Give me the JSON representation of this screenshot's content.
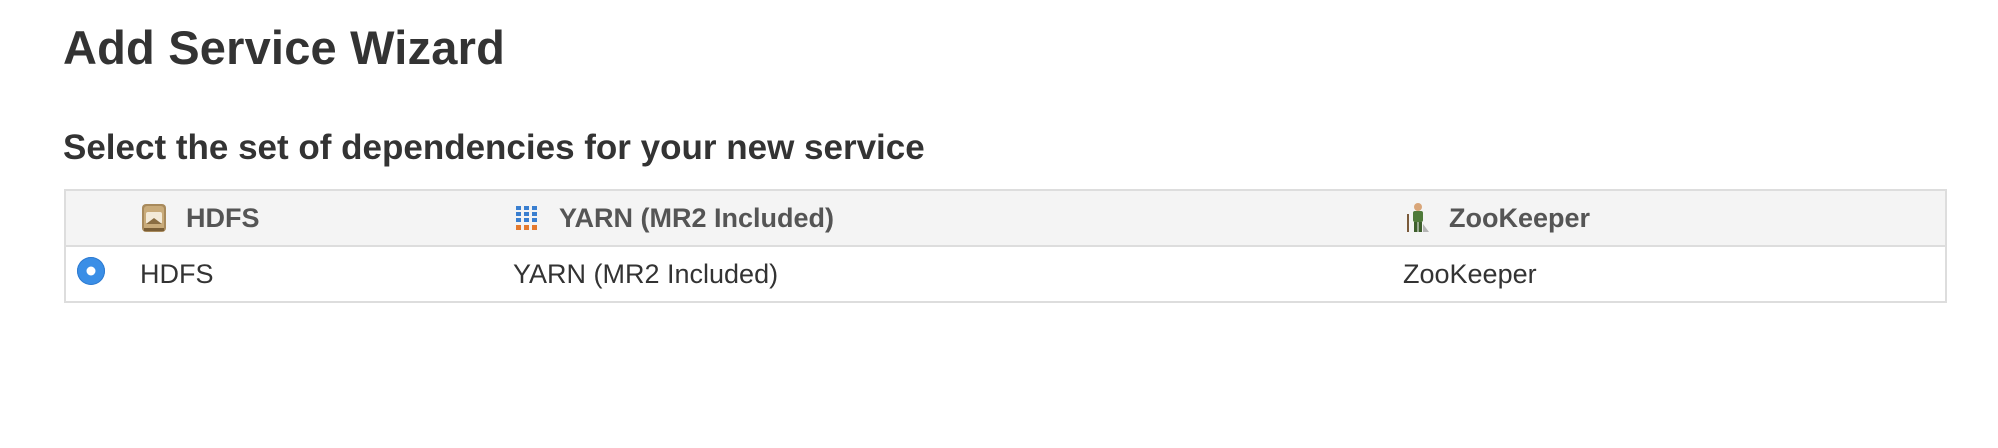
{
  "page": {
    "title": "Add Service Wizard",
    "subtitle": "Select the set of dependencies for your new service"
  },
  "table": {
    "headers": [
      {
        "label": "HDFS",
        "icon": "hdfs-icon"
      },
      {
        "label": "YARN (MR2 Included)",
        "icon": "yarn-icon"
      },
      {
        "label": "ZooKeeper",
        "icon": "zookeeper-icon"
      }
    ],
    "rows": [
      {
        "selected": true,
        "cells": [
          "HDFS",
          "YARN (MR2 Included)",
          "ZooKeeper"
        ]
      }
    ]
  },
  "colors": {
    "radio_selected": "#3a8ee6",
    "header_bg": "#f4f4f4",
    "border": "#dddddd",
    "text": "#333333"
  }
}
